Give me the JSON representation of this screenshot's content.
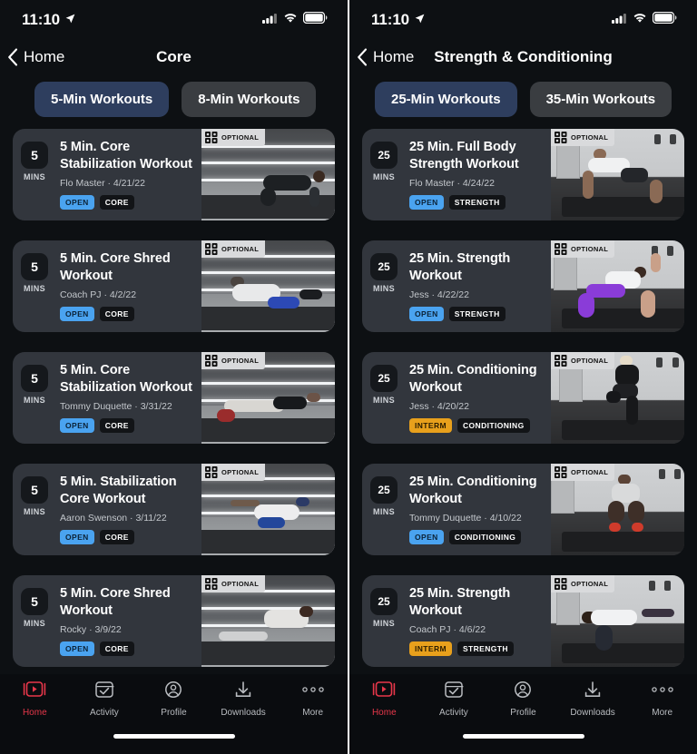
{
  "status_bar": {
    "time": "11:10",
    "location_icon": "location-arrow-icon",
    "cellular_icon": "cellular-bars-icon",
    "wifi_icon": "wifi-icon",
    "battery_icon": "battery-full-icon"
  },
  "panels": [
    {
      "nav": {
        "back_label": "Home",
        "back_icon": "chevron-left-icon",
        "title": "Core"
      },
      "filters": [
        {
          "label": "5-Min Workouts",
          "active": true
        },
        {
          "label": "8-Min Workouts",
          "active": false
        }
      ],
      "cards": [
        {
          "minutes": "5",
          "minutes_label": "MINS",
          "title": "5 Min. Core Stabilization Workout",
          "meta": "Flo Master · 4/21/22",
          "level_tag": "OPEN",
          "level_type": "open",
          "category_tag": "CORE",
          "badge": "OPTIONAL",
          "badge_icon": "weight-plates-icon",
          "scene": "gym"
        },
        {
          "minutes": "5",
          "minutes_label": "MINS",
          "title": "5 Min. Core Shred Workout",
          "meta": "Coach PJ · 4/2/22",
          "level_tag": "OPEN",
          "level_type": "open",
          "category_tag": "CORE",
          "badge": "OPTIONAL",
          "badge_icon": "weight-plates-icon",
          "scene": "gym"
        },
        {
          "minutes": "5",
          "minutes_label": "MINS",
          "title": "5 Min. Core Stabilization Workout",
          "meta": "Tommy Duquette · 3/31/22",
          "level_tag": "OPEN",
          "level_type": "open",
          "category_tag": "CORE",
          "badge": "OPTIONAL",
          "badge_icon": "weight-plates-icon",
          "scene": "gym"
        },
        {
          "minutes": "5",
          "minutes_label": "MINS",
          "title": "5 Min. Stabilization Core Workout",
          "meta": "Aaron Swenson · 3/11/22",
          "level_tag": "OPEN",
          "level_type": "open",
          "category_tag": "CORE",
          "badge": "OPTIONAL",
          "badge_icon": "weight-plates-icon",
          "scene": "gym"
        },
        {
          "minutes": "5",
          "minutes_label": "MINS",
          "title": "5 Min. Core Shred Workout",
          "meta": "Rocky · 3/9/22",
          "level_tag": "OPEN",
          "level_type": "open",
          "category_tag": "CORE",
          "badge": "OPTIONAL",
          "badge_icon": "weight-plates-icon",
          "scene": "gym"
        }
      ]
    },
    {
      "nav": {
        "back_label": "Home",
        "back_icon": "chevron-left-icon",
        "title": "Strength & Conditioning"
      },
      "filters": [
        {
          "label": "25-Min Workouts",
          "active": true
        },
        {
          "label": "35-Min Workouts",
          "active": false
        }
      ],
      "cards": [
        {
          "minutes": "25",
          "minutes_label": "MINS",
          "title": "25 Min. Full Body Strength Workout",
          "meta": "Flo Master · 4/24/22",
          "level_tag": "OPEN",
          "level_type": "open",
          "category_tag": "STRENGTH",
          "badge": "OPTIONAL",
          "badge_icon": "weight-plates-icon",
          "scene": "studio"
        },
        {
          "minutes": "25",
          "minutes_label": "MINS",
          "title": "25 Min. Strength Workout",
          "meta": "Jess · 4/22/22",
          "level_tag": "OPEN",
          "level_type": "open",
          "category_tag": "STRENGTH",
          "badge": "OPTIONAL",
          "badge_icon": "weight-plates-icon",
          "scene": "studio"
        },
        {
          "minutes": "25",
          "minutes_label": "MINS",
          "title": "25 Min. Conditioning Workout",
          "meta": "Jess · 4/20/22",
          "level_tag": "INTERM",
          "level_type": "interm",
          "category_tag": "CONDITIONING",
          "badge": "OPTIONAL",
          "badge_icon": "weight-plates-icon",
          "scene": "studio"
        },
        {
          "minutes": "25",
          "minutes_label": "MINS",
          "title": "25 Min. Conditioning Workout",
          "meta": "Tommy Duquette · 4/10/22",
          "level_tag": "OPEN",
          "level_type": "open",
          "category_tag": "CONDITIONING",
          "badge": "OPTIONAL",
          "badge_icon": "weight-plates-icon",
          "scene": "studio"
        },
        {
          "minutes": "25",
          "minutes_label": "MINS",
          "title": "25 Min. Strength Workout",
          "meta": "Coach PJ · 4/6/22",
          "level_tag": "INTERM",
          "level_type": "interm",
          "category_tag": "STRENGTH",
          "badge": "OPTIONAL",
          "badge_icon": "weight-plates-icon",
          "scene": "studio"
        }
      ]
    }
  ],
  "tabbar": {
    "items": [
      {
        "label": "Home",
        "icon": "play-video-icon",
        "active": true
      },
      {
        "label": "Activity",
        "icon": "checkbox-calendar-icon",
        "active": false
      },
      {
        "label": "Profile",
        "icon": "person-circle-icon",
        "active": false
      },
      {
        "label": "Downloads",
        "icon": "download-arrow-icon",
        "active": false
      },
      {
        "label": "More",
        "icon": "ellipsis-icon",
        "active": false
      }
    ]
  },
  "colors": {
    "accent_red": "#e8374a",
    "pill_active": "#2e3e5e",
    "pill_inactive": "#3a3d41",
    "card_bg": "#32363d",
    "tag_open": "#4aa3f0",
    "tag_interm": "#e8a01c",
    "background": "#0d1013"
  }
}
